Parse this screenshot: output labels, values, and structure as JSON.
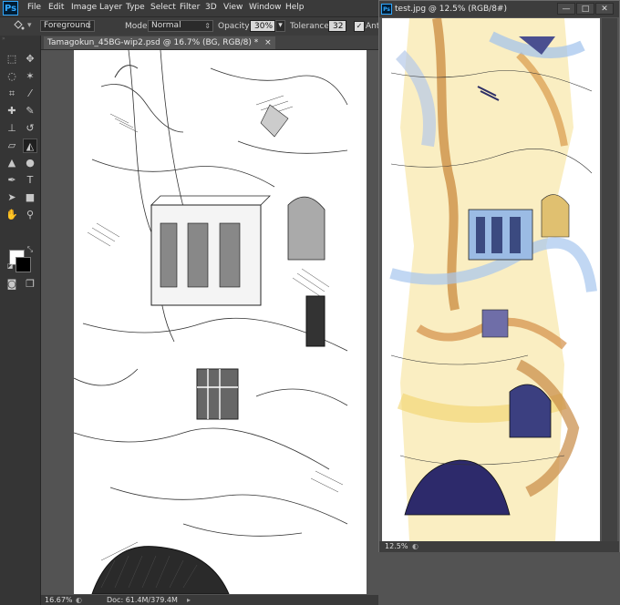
{
  "menubar": {
    "logo": "Ps",
    "items": [
      "File",
      "Edit",
      "Image",
      "Layer",
      "Type",
      "Select",
      "Filter",
      "3D",
      "View",
      "Window",
      "Help"
    ]
  },
  "options": {
    "fill_source": "Foreground",
    "mode_label": "Mode:",
    "mode_value": "Normal",
    "opacity_label": "Opacity:",
    "opacity_value": "30%",
    "tolerance_label": "Tolerance:",
    "tolerance_value": "32",
    "antialias_label": "Anti",
    "antialias_checked": true
  },
  "document": {
    "tab_title": "Tamagokun_45BG-wip2.psd @ 16.7% (BG, RGB/8) *",
    "close_glyph": "×",
    "zoom": "16.67%",
    "doc_info": "Doc: 61.4M/379.4M"
  },
  "floating_window": {
    "logo": "Ps",
    "title": "test.jpg @ 12.5% (RGB/8#)",
    "zoom": "12.5%",
    "buttons": [
      "—",
      "□",
      "✕"
    ]
  },
  "colors": {
    "foreground": "#ffffff",
    "background": "#000000",
    "app_bg": "#535353",
    "accent": "#31a8ff"
  }
}
